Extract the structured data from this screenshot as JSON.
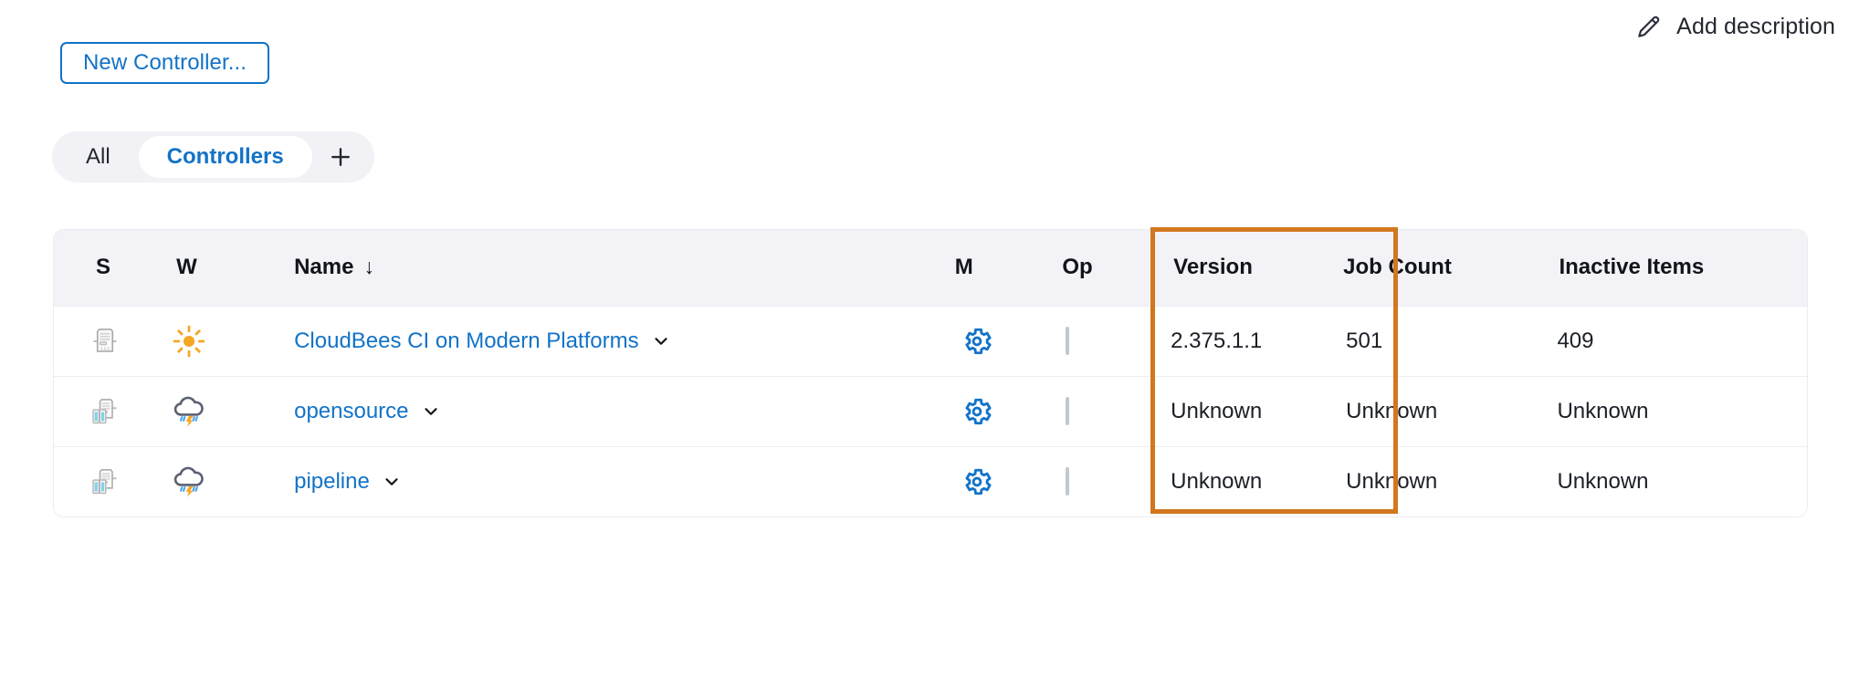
{
  "topbar": {
    "add_description_label": "Add description",
    "pencil_icon": "pencil-icon"
  },
  "actions": {
    "new_controller_label": "New Controller..."
  },
  "tabs": {
    "items": [
      {
        "label": "All",
        "active": false
      },
      {
        "label": "Controllers",
        "active": true
      }
    ],
    "add_tab_icon": "plus-icon"
  },
  "table": {
    "columns": [
      {
        "key": "status",
        "label": "S"
      },
      {
        "key": "weather",
        "label": "W"
      },
      {
        "key": "name",
        "label": "Name",
        "sort": "↓"
      },
      {
        "key": "manage",
        "label": "M"
      },
      {
        "key": "op",
        "label": "Op"
      },
      {
        "key": "version",
        "label": "Version"
      },
      {
        "key": "job_count",
        "label": "Job Count"
      },
      {
        "key": "inactive_items",
        "label": "Inactive Items"
      }
    ],
    "rows": [
      {
        "status_icon": "server-icon",
        "weather_icon": "sunny-icon",
        "name": "CloudBees CI on Modern Platforms",
        "manage_icon": "gear-icon",
        "op_checked": false,
        "version": "2.375.1.1",
        "job_count": "501",
        "inactive_items": "409"
      },
      {
        "status_icon": "server-stack-icon",
        "weather_icon": "storm-icon",
        "name": "opensource",
        "manage_icon": "gear-icon",
        "op_checked": false,
        "version": "Unknown",
        "job_count": "Unknown",
        "inactive_items": "Unknown"
      },
      {
        "status_icon": "server-stack-icon",
        "weather_icon": "storm-icon",
        "name": "pipeline",
        "manage_icon": "gear-icon",
        "op_checked": false,
        "version": "Unknown",
        "job_count": "Unknown",
        "inactive_items": "Unknown"
      }
    ]
  },
  "highlight": {
    "target_column": "Inactive Items",
    "color": "#d2771f"
  },
  "colors": {
    "link": "#1273c8",
    "accent": "#1273c8",
    "header_bg": "#f3f3f7",
    "pill_bg": "#f2f2f6",
    "text": "#23272f",
    "highlight": "#d2771f"
  }
}
